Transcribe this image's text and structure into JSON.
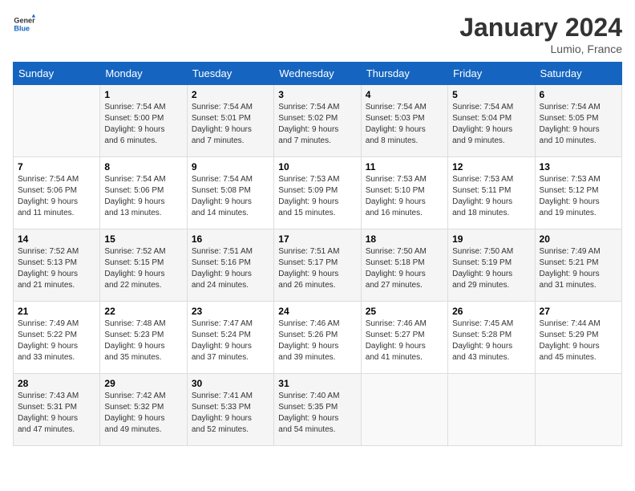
{
  "logo": {
    "text_general": "General",
    "text_blue": "Blue"
  },
  "title": "January 2024",
  "subtitle": "Lumio, France",
  "days_header": [
    "Sunday",
    "Monday",
    "Tuesday",
    "Wednesday",
    "Thursday",
    "Friday",
    "Saturday"
  ],
  "weeks": [
    [
      {
        "date": "",
        "info": ""
      },
      {
        "date": "1",
        "info": "Sunrise: 7:54 AM\nSunset: 5:00 PM\nDaylight: 9 hours\nand 6 minutes."
      },
      {
        "date": "2",
        "info": "Sunrise: 7:54 AM\nSunset: 5:01 PM\nDaylight: 9 hours\nand 7 minutes."
      },
      {
        "date": "3",
        "info": "Sunrise: 7:54 AM\nSunset: 5:02 PM\nDaylight: 9 hours\nand 7 minutes."
      },
      {
        "date": "4",
        "info": "Sunrise: 7:54 AM\nSunset: 5:03 PM\nDaylight: 9 hours\nand 8 minutes."
      },
      {
        "date": "5",
        "info": "Sunrise: 7:54 AM\nSunset: 5:04 PM\nDaylight: 9 hours\nand 9 minutes."
      },
      {
        "date": "6",
        "info": "Sunrise: 7:54 AM\nSunset: 5:05 PM\nDaylight: 9 hours\nand 10 minutes."
      }
    ],
    [
      {
        "date": "7",
        "info": ""
      },
      {
        "date": "8",
        "info": "Sunrise: 7:54 AM\nSunset: 5:06 PM\nDaylight: 9 hours\nand 13 minutes."
      },
      {
        "date": "9",
        "info": "Sunrise: 7:54 AM\nSunset: 5:08 PM\nDaylight: 9 hours\nand 14 minutes."
      },
      {
        "date": "10",
        "info": "Sunrise: 7:53 AM\nSunset: 5:09 PM\nDaylight: 9 hours\nand 15 minutes."
      },
      {
        "date": "11",
        "info": "Sunrise: 7:53 AM\nSunset: 5:10 PM\nDaylight: 9 hours\nand 16 minutes."
      },
      {
        "date": "12",
        "info": "Sunrise: 7:53 AM\nSunset: 5:11 PM\nDaylight: 9 hours\nand 18 minutes."
      },
      {
        "date": "13",
        "info": "Sunrise: 7:53 AM\nSunset: 5:12 PM\nDaylight: 9 hours\nand 19 minutes."
      }
    ],
    [
      {
        "date": "14",
        "info": ""
      },
      {
        "date": "15",
        "info": "Sunrise: 7:52 AM\nSunset: 5:15 PM\nDaylight: 9 hours\nand 22 minutes."
      },
      {
        "date": "16",
        "info": "Sunrise: 7:51 AM\nSunset: 5:16 PM\nDaylight: 9 hours\nand 24 minutes."
      },
      {
        "date": "17",
        "info": "Sunrise: 7:51 AM\nSunset: 5:17 PM\nDaylight: 9 hours\nand 26 minutes."
      },
      {
        "date": "18",
        "info": "Sunrise: 7:50 AM\nSunset: 5:18 PM\nDaylight: 9 hours\nand 27 minutes."
      },
      {
        "date": "19",
        "info": "Sunrise: 7:50 AM\nSunset: 5:19 PM\nDaylight: 9 hours\nand 29 minutes."
      },
      {
        "date": "20",
        "info": "Sunrise: 7:49 AM\nSunset: 5:21 PM\nDaylight: 9 hours\nand 31 minutes."
      }
    ],
    [
      {
        "date": "21",
        "info": ""
      },
      {
        "date": "22",
        "info": "Sunrise: 7:48 AM\nSunset: 5:23 PM\nDaylight: 9 hours\nand 35 minutes."
      },
      {
        "date": "23",
        "info": "Sunrise: 7:47 AM\nSunset: 5:24 PM\nDaylight: 9 hours\nand 37 minutes."
      },
      {
        "date": "24",
        "info": "Sunrise: 7:46 AM\nSunset: 5:26 PM\nDaylight: 9 hours\nand 39 minutes."
      },
      {
        "date": "25",
        "info": "Sunrise: 7:46 AM\nSunset: 5:27 PM\nDaylight: 9 hours\nand 41 minutes."
      },
      {
        "date": "26",
        "info": "Sunrise: 7:45 AM\nSunset: 5:28 PM\nDaylight: 9 hours\nand 43 minutes."
      },
      {
        "date": "27",
        "info": "Sunrise: 7:44 AM\nSunset: 5:29 PM\nDaylight: 9 hours\nand 45 minutes."
      }
    ],
    [
      {
        "date": "28",
        "info": ""
      },
      {
        "date": "29",
        "info": "Sunrise: 7:42 AM\nSunset: 5:32 PM\nDaylight: 9 hours\nand 49 minutes."
      },
      {
        "date": "30",
        "info": "Sunrise: 7:41 AM\nSunset: 5:33 PM\nDaylight: 9 hours\nand 52 minutes."
      },
      {
        "date": "31",
        "info": "Sunrise: 7:40 AM\nSunset: 5:35 PM\nDaylight: 9 hours\nand 54 minutes."
      },
      {
        "date": "",
        "info": ""
      },
      {
        "date": "",
        "info": ""
      },
      {
        "date": "",
        "info": ""
      }
    ]
  ],
  "week0_sunday_info": "Sunrise: 7:54 AM\nSunset: 5:06 PM\nDaylight: 9 hours\nand 11 minutes.",
  "week1_sunday_info": "Sunrise: 7:54 AM\nSunset: 5:06 PM\nDaylight: 9 hours\nand 11 minutes.",
  "week2_sunday_info": "Sunrise: 7:52 AM\nSunset: 5:13 PM\nDaylight: 9 hours\nand 21 minutes.",
  "week3_sunday_info": "Sunrise: 7:49 AM\nSunset: 5:22 PM\nDaylight: 9 hours\nand 33 minutes.",
  "week4_sunday_info": "Sunrise: 7:43 AM\nSunset: 5:31 PM\nDaylight: 9 hours\nand 47 minutes."
}
